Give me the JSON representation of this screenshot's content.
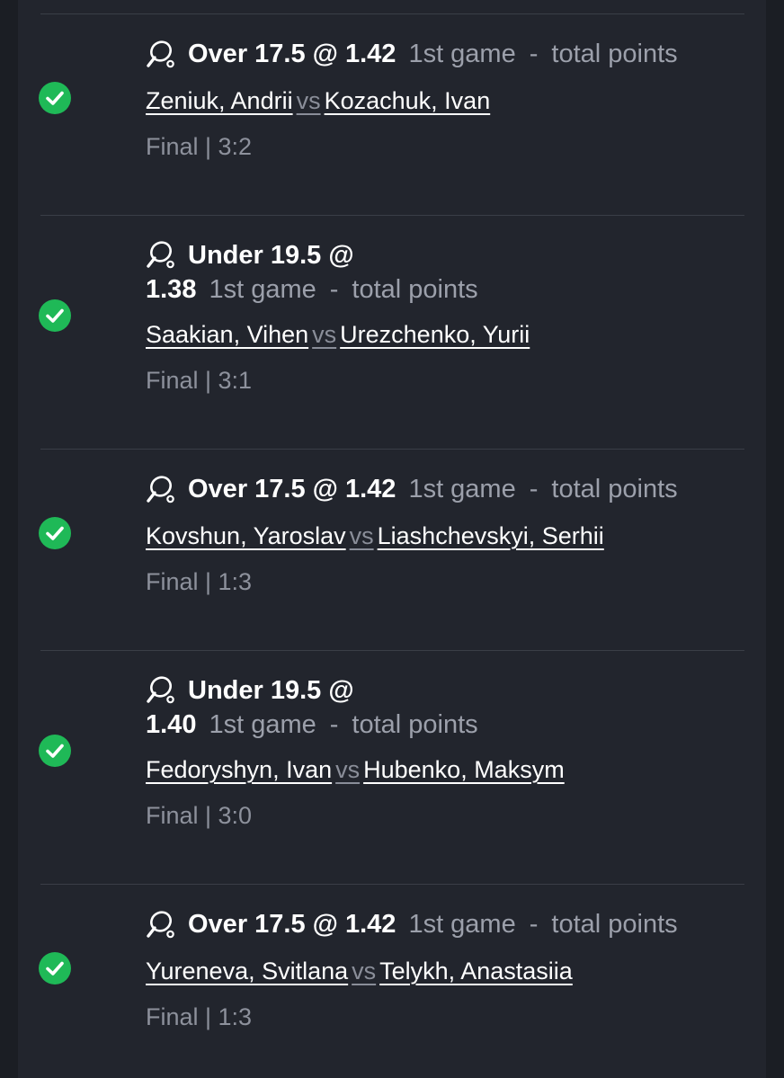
{
  "bets": [
    {
      "selection": "Over 17.5 @ 1.42",
      "selection_line2": "",
      "market": "1st game",
      "separator": "-",
      "market_detail": "total points",
      "player1": "Zeniuk, Andrii",
      "vs": "vs",
      "player2": "Kozachuk, Ivan",
      "status": "Final | 3:2",
      "result_icon": "check-circle-icon",
      "sport_icon": "table-tennis-icon"
    },
    {
      "selection": "Under 19.5 @",
      "selection_line2": "1.38",
      "market": "1st game",
      "separator": "-",
      "market_detail": "total points",
      "player1": "Saakian, Vihen",
      "vs": "vs",
      "player2": "Urezchenko, Yurii",
      "status": "Final | 3:1",
      "result_icon": "check-circle-icon",
      "sport_icon": "table-tennis-icon"
    },
    {
      "selection": "Over 17.5 @ 1.42",
      "selection_line2": "",
      "market": "1st game",
      "separator": "-",
      "market_detail": "total points",
      "player1": "Kovshun, Yaroslav",
      "vs": "vs",
      "player2": "Liashchevskyi, Serhii",
      "status": "Final | 1:3",
      "result_icon": "check-circle-icon",
      "sport_icon": "table-tennis-icon"
    },
    {
      "selection": "Under 19.5 @",
      "selection_line2": "1.40",
      "market": "1st game",
      "separator": "-",
      "market_detail": "total points",
      "player1": "Fedoryshyn, Ivan",
      "vs": "vs",
      "player2": "Hubenko, Maksym",
      "status": "Final | 3:0",
      "result_icon": "check-circle-icon",
      "sport_icon": "table-tennis-icon"
    },
    {
      "selection": "Over 17.5 @ 1.42",
      "selection_line2": "",
      "market": "1st game",
      "separator": "-",
      "market_detail": "total points",
      "player1": "Yureneva, Svitlana",
      "vs": "vs",
      "player2": "Telykh, Anastasiia",
      "status": "Final | 1:3",
      "result_icon": "check-circle-icon",
      "sport_icon": "table-tennis-icon"
    }
  ],
  "colors": {
    "background": "#1b1e24",
    "panel": "#22252d",
    "win_green": "#1fb957",
    "text_primary": "#ffffff",
    "text_secondary": "#9ca0ab"
  }
}
